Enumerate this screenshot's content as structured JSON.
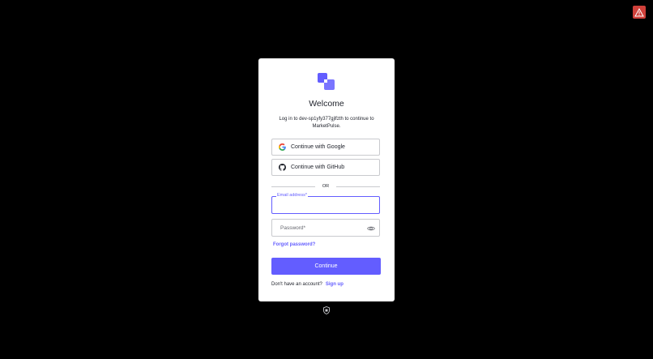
{
  "alert": {
    "icon": "warning-icon",
    "color": "#d0403a"
  },
  "login": {
    "title": "Welcome",
    "subtitle": "Log in to dev-sp1yfy377gjlfzth to continue to MarketPulse.",
    "google_label": "Continue with Google",
    "github_label": "Continue with GitHub",
    "divider_text": "OR",
    "email_label": "Email address*",
    "email_value": "",
    "password_placeholder": "Password*",
    "forgot_password": "Forgot password?",
    "continue_label": "Continue",
    "signup_prompt": "Don't have an account?",
    "signup_link": "Sign up"
  },
  "colors": {
    "accent": "#635dff",
    "background": "#000000",
    "card": "#ffffff"
  }
}
